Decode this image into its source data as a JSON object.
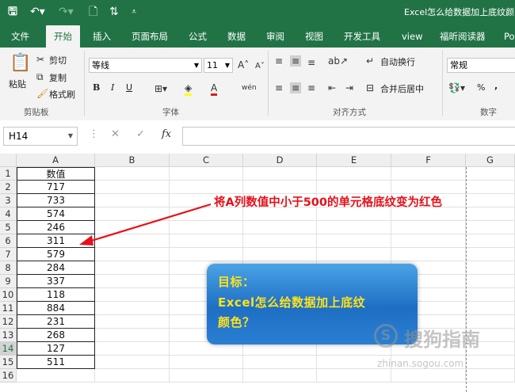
{
  "window": {
    "title": "Excel怎么给数据加上底纹颜"
  },
  "ribbon_tabs": [
    "文件",
    "开始",
    "插入",
    "页面布局",
    "公式",
    "数据",
    "审阅",
    "视图",
    "开发工具",
    "view",
    "福昕阅读器",
    "Po"
  ],
  "ribbon": {
    "clipboard": {
      "paste": "粘贴",
      "cut": "剪切",
      "copy": "复制",
      "format_painter": "格式刷",
      "group": "剪贴板"
    },
    "font": {
      "name": "等线",
      "size": "11",
      "bold": "B",
      "italic": "I",
      "underline": "U",
      "group": "字体"
    },
    "alignment": {
      "wrap": "自动换行",
      "merge": "合并后居中",
      "group": "对齐方式"
    },
    "number": {
      "format": "常规",
      "percent": "%",
      "comma": ",",
      "group": "数字"
    }
  },
  "formula_bar": {
    "name_box": "H14",
    "fx": "fx",
    "content": ""
  },
  "columns": [
    "A",
    "B",
    "C",
    "D",
    "E",
    "F",
    "G"
  ],
  "rows": [
    "1",
    "2",
    "3",
    "4",
    "5",
    "6",
    "7",
    "8",
    "9",
    "10",
    "11",
    "12",
    "13",
    "14",
    "15",
    "16"
  ],
  "column_a": [
    "数值",
    "717",
    "733",
    "574",
    "246",
    "311",
    "579",
    "284",
    "337",
    "118",
    "884",
    "231",
    "268",
    "127",
    "511",
    ""
  ],
  "annotation": {
    "text": "将A列数值中小于500的单元格底纹变为红色",
    "color": "#e8101a"
  },
  "callout": {
    "line1": "目标：",
    "line2": "Excel怎么给数据加上底纹",
    "line3": "颜色？"
  },
  "watermark": {
    "logo": "S",
    "brand": "搜狗指南",
    "url": "zhinan.sogou.com"
  },
  "colors": {
    "excel_green": "#217346",
    "callout_blue": "#1e6fc4",
    "callout_text": "#ffe21a"
  }
}
